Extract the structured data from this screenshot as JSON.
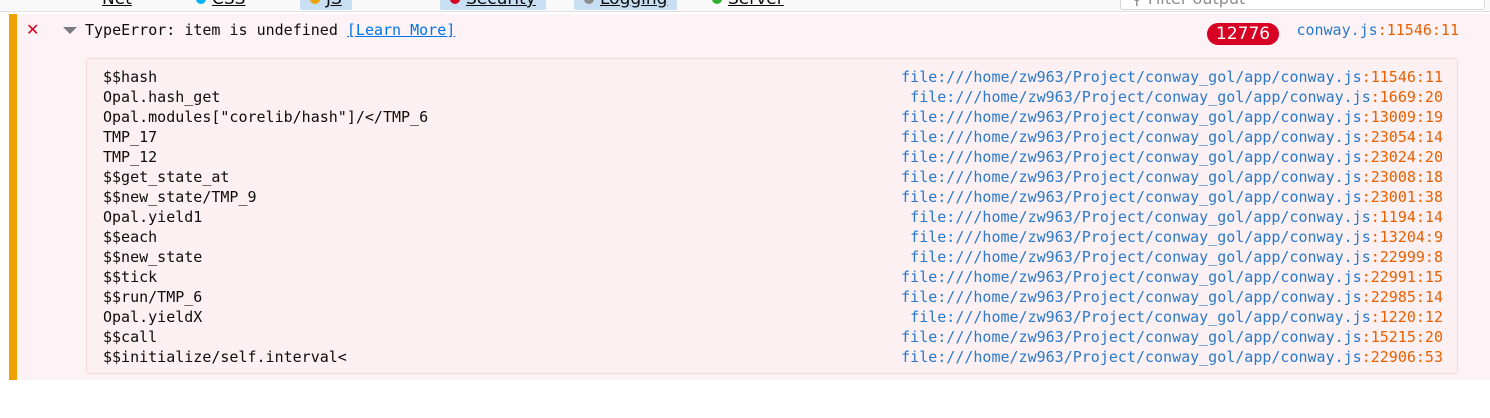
{
  "toolbar": {
    "items": [
      {
        "label": "Net"
      },
      {
        "label": "CSS"
      },
      {
        "label": "JS"
      },
      {
        "label": "Security"
      },
      {
        "label": "Logging"
      },
      {
        "label": "Server"
      }
    ],
    "filter_placeholder": "Filter output"
  },
  "message": {
    "level": "error",
    "icon": "error-x-icon",
    "text": "TypeError: item is undefined",
    "learn_more": "[Learn More]",
    "repeat_count": "12776",
    "location_file": "conway.js",
    "location_line": ":11546:11"
  },
  "stacktrace": [
    {
      "fn": "$$hash",
      "file": "file:///home/zw963/Project/conway_gol/app/conway.js",
      "lc": ":11546:11"
    },
    {
      "fn": "Opal.hash_get",
      "file": "file:///home/zw963/Project/conway_gol/app/conway.js",
      "lc": ":1669:20"
    },
    {
      "fn": "Opal.modules[\"corelib/hash\"]/</TMP_6",
      "file": "file:///home/zw963/Project/conway_gol/app/conway.js",
      "lc": ":13009:19"
    },
    {
      "fn": "TMP_17",
      "file": "file:///home/zw963/Project/conway_gol/app/conway.js",
      "lc": ":23054:14"
    },
    {
      "fn": "TMP_12",
      "file": "file:///home/zw963/Project/conway_gol/app/conway.js",
      "lc": ":23024:20"
    },
    {
      "fn": "$$get_state_at",
      "file": "file:///home/zw963/Project/conway_gol/app/conway.js",
      "lc": ":23008:18"
    },
    {
      "fn": "$$new_state/TMP_9",
      "file": "file:///home/zw963/Project/conway_gol/app/conway.js",
      "lc": ":23001:38"
    },
    {
      "fn": "Opal.yield1",
      "file": "file:///home/zw963/Project/conway_gol/app/conway.js",
      "lc": ":1194:14"
    },
    {
      "fn": "$$each",
      "file": "file:///home/zw963/Project/conway_gol/app/conway.js",
      "lc": ":13204:9"
    },
    {
      "fn": "$$new_state",
      "file": "file:///home/zw963/Project/conway_gol/app/conway.js",
      "lc": ":22999:8"
    },
    {
      "fn": "$$tick",
      "file": "file:///home/zw963/Project/conway_gol/app/conway.js",
      "lc": ":22991:15"
    },
    {
      "fn": "$$run/TMP_6",
      "file": "file:///home/zw963/Project/conway_gol/app/conway.js",
      "lc": ":22985:14"
    },
    {
      "fn": "Opal.yieldX",
      "file": "file:///home/zw963/Project/conway_gol/app/conway.js",
      "lc": ":1220:12"
    },
    {
      "fn": "$$call",
      "file": "file:///home/zw963/Project/conway_gol/app/conway.js",
      "lc": ":15215:20"
    },
    {
      "fn": "$$initialize/self.interval<",
      "file": "file:///home/zw963/Project/conway_gol/app/conway.js",
      "lc": ":22906:53"
    }
  ],
  "colors": {
    "error_bg": "#fdf2f5",
    "error_accent": "#f0a000",
    "badge": "#d70022",
    "link": "#2a79c8",
    "line_col": "#e66000"
  }
}
